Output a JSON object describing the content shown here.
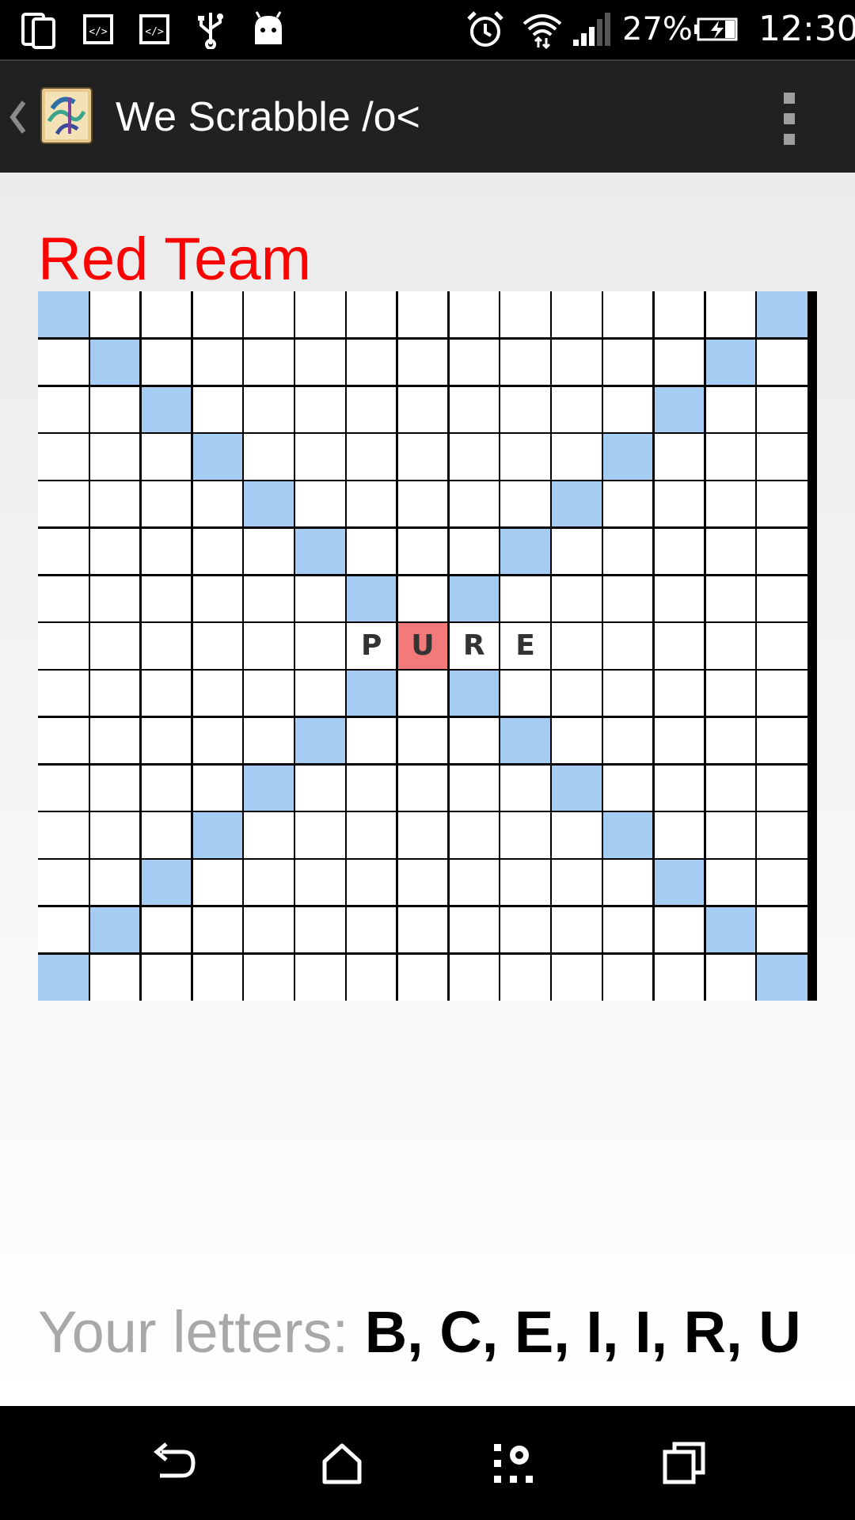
{
  "status_bar": {
    "left_icons": [
      "dual-screen-icon",
      "code-icon",
      "code-icon",
      "usb-icon",
      "android-icon"
    ],
    "right_icons": [
      "alarm-icon",
      "wifi-icon",
      "cell-signal-icon",
      "battery-charging-icon"
    ],
    "battery_percent": "27%",
    "time": "12:30"
  },
  "action_bar": {
    "title": "We Scrabble /o<",
    "icons": [
      "back-chevron-icon",
      "app-logo-icon",
      "overflow-menu-icon"
    ]
  },
  "game": {
    "team_name": "Red Team",
    "team_color": "#ff0000",
    "board": {
      "rows": 15,
      "cols": 15,
      "premium_color": "#a5cdf3",
      "highlight_color": "#f47a79",
      "premium_cells": [
        [
          0,
          0
        ],
        [
          0,
          14
        ],
        [
          1,
          1
        ],
        [
          1,
          13
        ],
        [
          2,
          2
        ],
        [
          2,
          12
        ],
        [
          3,
          3
        ],
        [
          3,
          11
        ],
        [
          4,
          4
        ],
        [
          4,
          10
        ],
        [
          5,
          5
        ],
        [
          5,
          9
        ],
        [
          6,
          6
        ],
        [
          6,
          8
        ],
        [
          8,
          6
        ],
        [
          8,
          8
        ],
        [
          9,
          5
        ],
        [
          9,
          9
        ],
        [
          10,
          4
        ],
        [
          10,
          10
        ],
        [
          11,
          3
        ],
        [
          11,
          11
        ],
        [
          12,
          2
        ],
        [
          12,
          12
        ],
        [
          13,
          1
        ],
        [
          13,
          13
        ],
        [
          14,
          0
        ],
        [
          14,
          14
        ]
      ],
      "tiles": [
        {
          "row": 7,
          "col": 6,
          "letter": "P"
        },
        {
          "row": 7,
          "col": 7,
          "letter": "U",
          "highlight": true
        },
        {
          "row": 7,
          "col": 8,
          "letter": "R"
        },
        {
          "row": 7,
          "col": 9,
          "letter": "E"
        }
      ]
    },
    "your_letters_label": "Your letters:",
    "your_letters": "B, C, E, I, I, R, U"
  },
  "nav_bar": {
    "buttons": [
      "back-icon",
      "home-icon",
      "apps-icon",
      "recents-icon"
    ]
  }
}
